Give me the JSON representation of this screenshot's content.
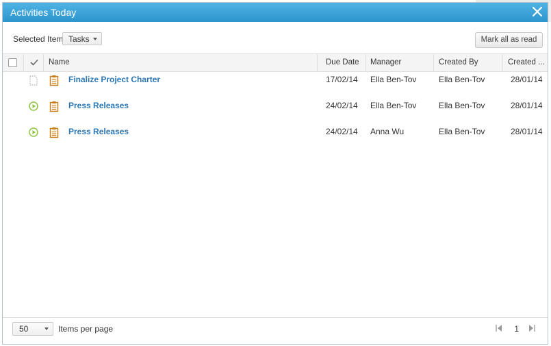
{
  "dialog": {
    "title": "Activities Today",
    "close_icon": "close-icon"
  },
  "toolbar": {
    "selected_item_label": "Selected Item",
    "selected_item_value": "Tasks",
    "mark_all_label": "Mark all as read"
  },
  "columns": {
    "select_all": "",
    "done": "",
    "name": "Name",
    "due_date": "Due Date",
    "manager": "Manager",
    "created_by": "Created By",
    "created": "Created ..."
  },
  "rows": [
    {
      "status_icon": "dotted-page-icon",
      "type_icon": "clipboard-icon",
      "name": "Finalize Project Charter",
      "due_date": "17/02/14",
      "manager": "Ella Ben-Tov",
      "created_by": "Ella Ben-Tov",
      "created": "28/01/14"
    },
    {
      "status_icon": "play-circle-icon",
      "type_icon": "clipboard-icon",
      "name": "Press Releases",
      "due_date": "24/02/14",
      "manager": "Ella Ben-Tov",
      "created_by": "Ella Ben-Tov",
      "created": "28/01/14"
    },
    {
      "status_icon": "play-circle-icon",
      "type_icon": "clipboard-icon",
      "name": "Press Releases",
      "due_date": "24/02/14",
      "manager": "Anna Wu",
      "created_by": "Ella Ben-Tov",
      "created": "28/01/14"
    }
  ],
  "footer": {
    "per_page_value": "50",
    "per_page_label": "Items per page",
    "page_number": "1"
  },
  "colors": {
    "title_bar": "#2d95cd",
    "link": "#2b77b6",
    "play_icon": "#8cc63e",
    "clipboard_icon": "#c77c1e"
  }
}
